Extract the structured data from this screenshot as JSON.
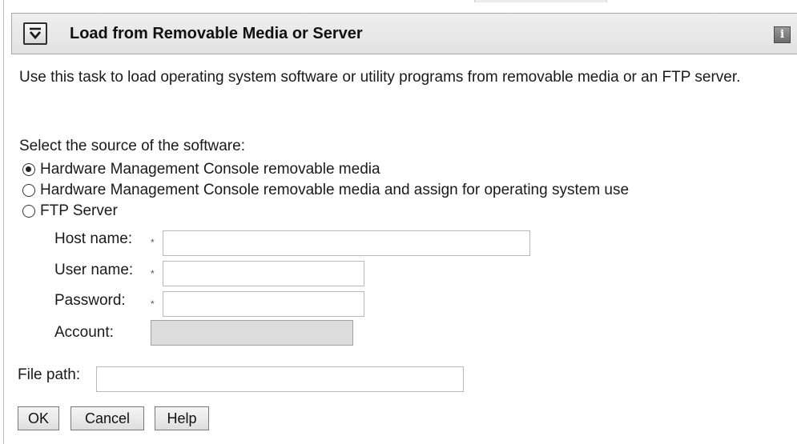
{
  "header": {
    "title": "Load from Removable Media or Server",
    "info_icon": "i"
  },
  "description": "Use this task to load operating system software or utility programs from removable media or an FTP server.",
  "source": {
    "label": "Select the source of the software:",
    "options": [
      {
        "label": "Hardware Management Console removable media",
        "selected": true
      },
      {
        "label": "Hardware Management Console removable media and assign for operating system use",
        "selected": false
      },
      {
        "label": "FTP Server",
        "selected": false
      }
    ]
  },
  "ftp": {
    "host_label": "Host name:",
    "user_label": "User name:",
    "password_label": "Password:",
    "account_label": "Account:",
    "required_marker": "*",
    "host_value": "",
    "user_value": "",
    "password_value": "",
    "account_value": ""
  },
  "file_path": {
    "label": "File path:",
    "value": ""
  },
  "buttons": {
    "ok": "OK",
    "cancel": "Cancel",
    "help": "Help"
  }
}
